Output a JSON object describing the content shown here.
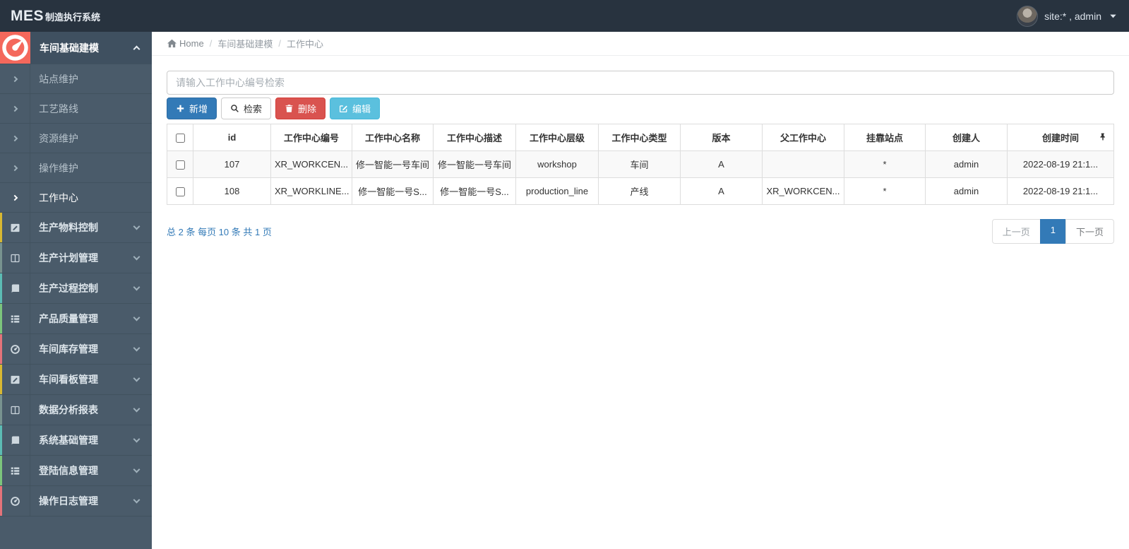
{
  "navbar": {
    "brand_primary": "MES",
    "brand_secondary": "制造执行系统",
    "user": "site:* , admin"
  },
  "breadcrumb": {
    "home": "Home",
    "separator": "/",
    "items": [
      "车间基础建模",
      "工作中心"
    ]
  },
  "sidebar": {
    "active_group": {
      "label": "车间基础建模",
      "icon": "gauge-icon"
    },
    "sub_items": [
      {
        "label": "站点维护",
        "active": false
      },
      {
        "label": "工艺路线",
        "active": false
      },
      {
        "label": "资源维护",
        "active": false
      },
      {
        "label": "操作维护",
        "active": false
      },
      {
        "label": "工作中心",
        "active": true
      }
    ],
    "groups": [
      {
        "label": "生产物料控制",
        "icon": "edit-square-icon",
        "strip": "#d8b832"
      },
      {
        "label": "生产计划管理",
        "icon": "columns-icon",
        "strip": "#78938f"
      },
      {
        "label": "生产过程控制",
        "icon": "book-icon",
        "strip": "#5cbcb4"
      },
      {
        "label": "产品质量管理",
        "icon": "th-list-icon",
        "strip": "#7cc57c"
      },
      {
        "label": "车间库存管理",
        "icon": "gauge-icon",
        "strip": "#e4737a"
      },
      {
        "label": "车间看板管理",
        "icon": "edit-square-icon",
        "strip": "#d8b832"
      },
      {
        "label": "数据分析报表",
        "icon": "columns-icon",
        "strip": "#78938f"
      },
      {
        "label": "系统基础管理",
        "icon": "book-icon",
        "strip": "#5cbcb4"
      },
      {
        "label": "登陆信息管理",
        "icon": "th-list-icon",
        "strip": "#7cc57c"
      },
      {
        "label": "操作日志管理",
        "icon": "gauge-icon",
        "strip": "#e4737a"
      }
    ]
  },
  "search": {
    "placeholder": "请输入工作中心编号检索",
    "value": ""
  },
  "toolbar": {
    "add_label": "新增",
    "search_label": "检索",
    "delete_label": "删除",
    "edit_label": "编辑"
  },
  "table": {
    "columns": [
      "id",
      "工作中心编号",
      "工作中心名称",
      "工作中心描述",
      "工作中心层级",
      "工作中心类型",
      "版本",
      "父工作中心",
      "挂靠站点",
      "创建人",
      "创建时间"
    ],
    "rows": [
      [
        "107",
        "XR_WORKCEN...",
        "修一智能一号车间",
        "修一智能一号车间",
        "workshop",
        "车间",
        "A",
        "",
        "*",
        "admin",
        "2022-08-19 21:1..."
      ],
      [
        "108",
        "XR_WORKLINE...",
        "修一智能一号S...",
        "修一智能一号S...",
        "production_line",
        "产线",
        "A",
        "XR_WORKCEN...",
        "*",
        "admin",
        "2022-08-19 21:1..."
      ]
    ]
  },
  "pagination": {
    "summary": "总 2 条 每页 10 条 共 1 页",
    "prev_label": "上一页",
    "page": "1",
    "next_label": "下一页"
  },
  "colors": {
    "navbar_bg": "#28333f",
    "sidebar_bg": "#4a5b6a",
    "active_icon_bg": "#f4685c",
    "primary": "#337ab7",
    "danger": "#d9534f",
    "info": "#5bc0de"
  }
}
